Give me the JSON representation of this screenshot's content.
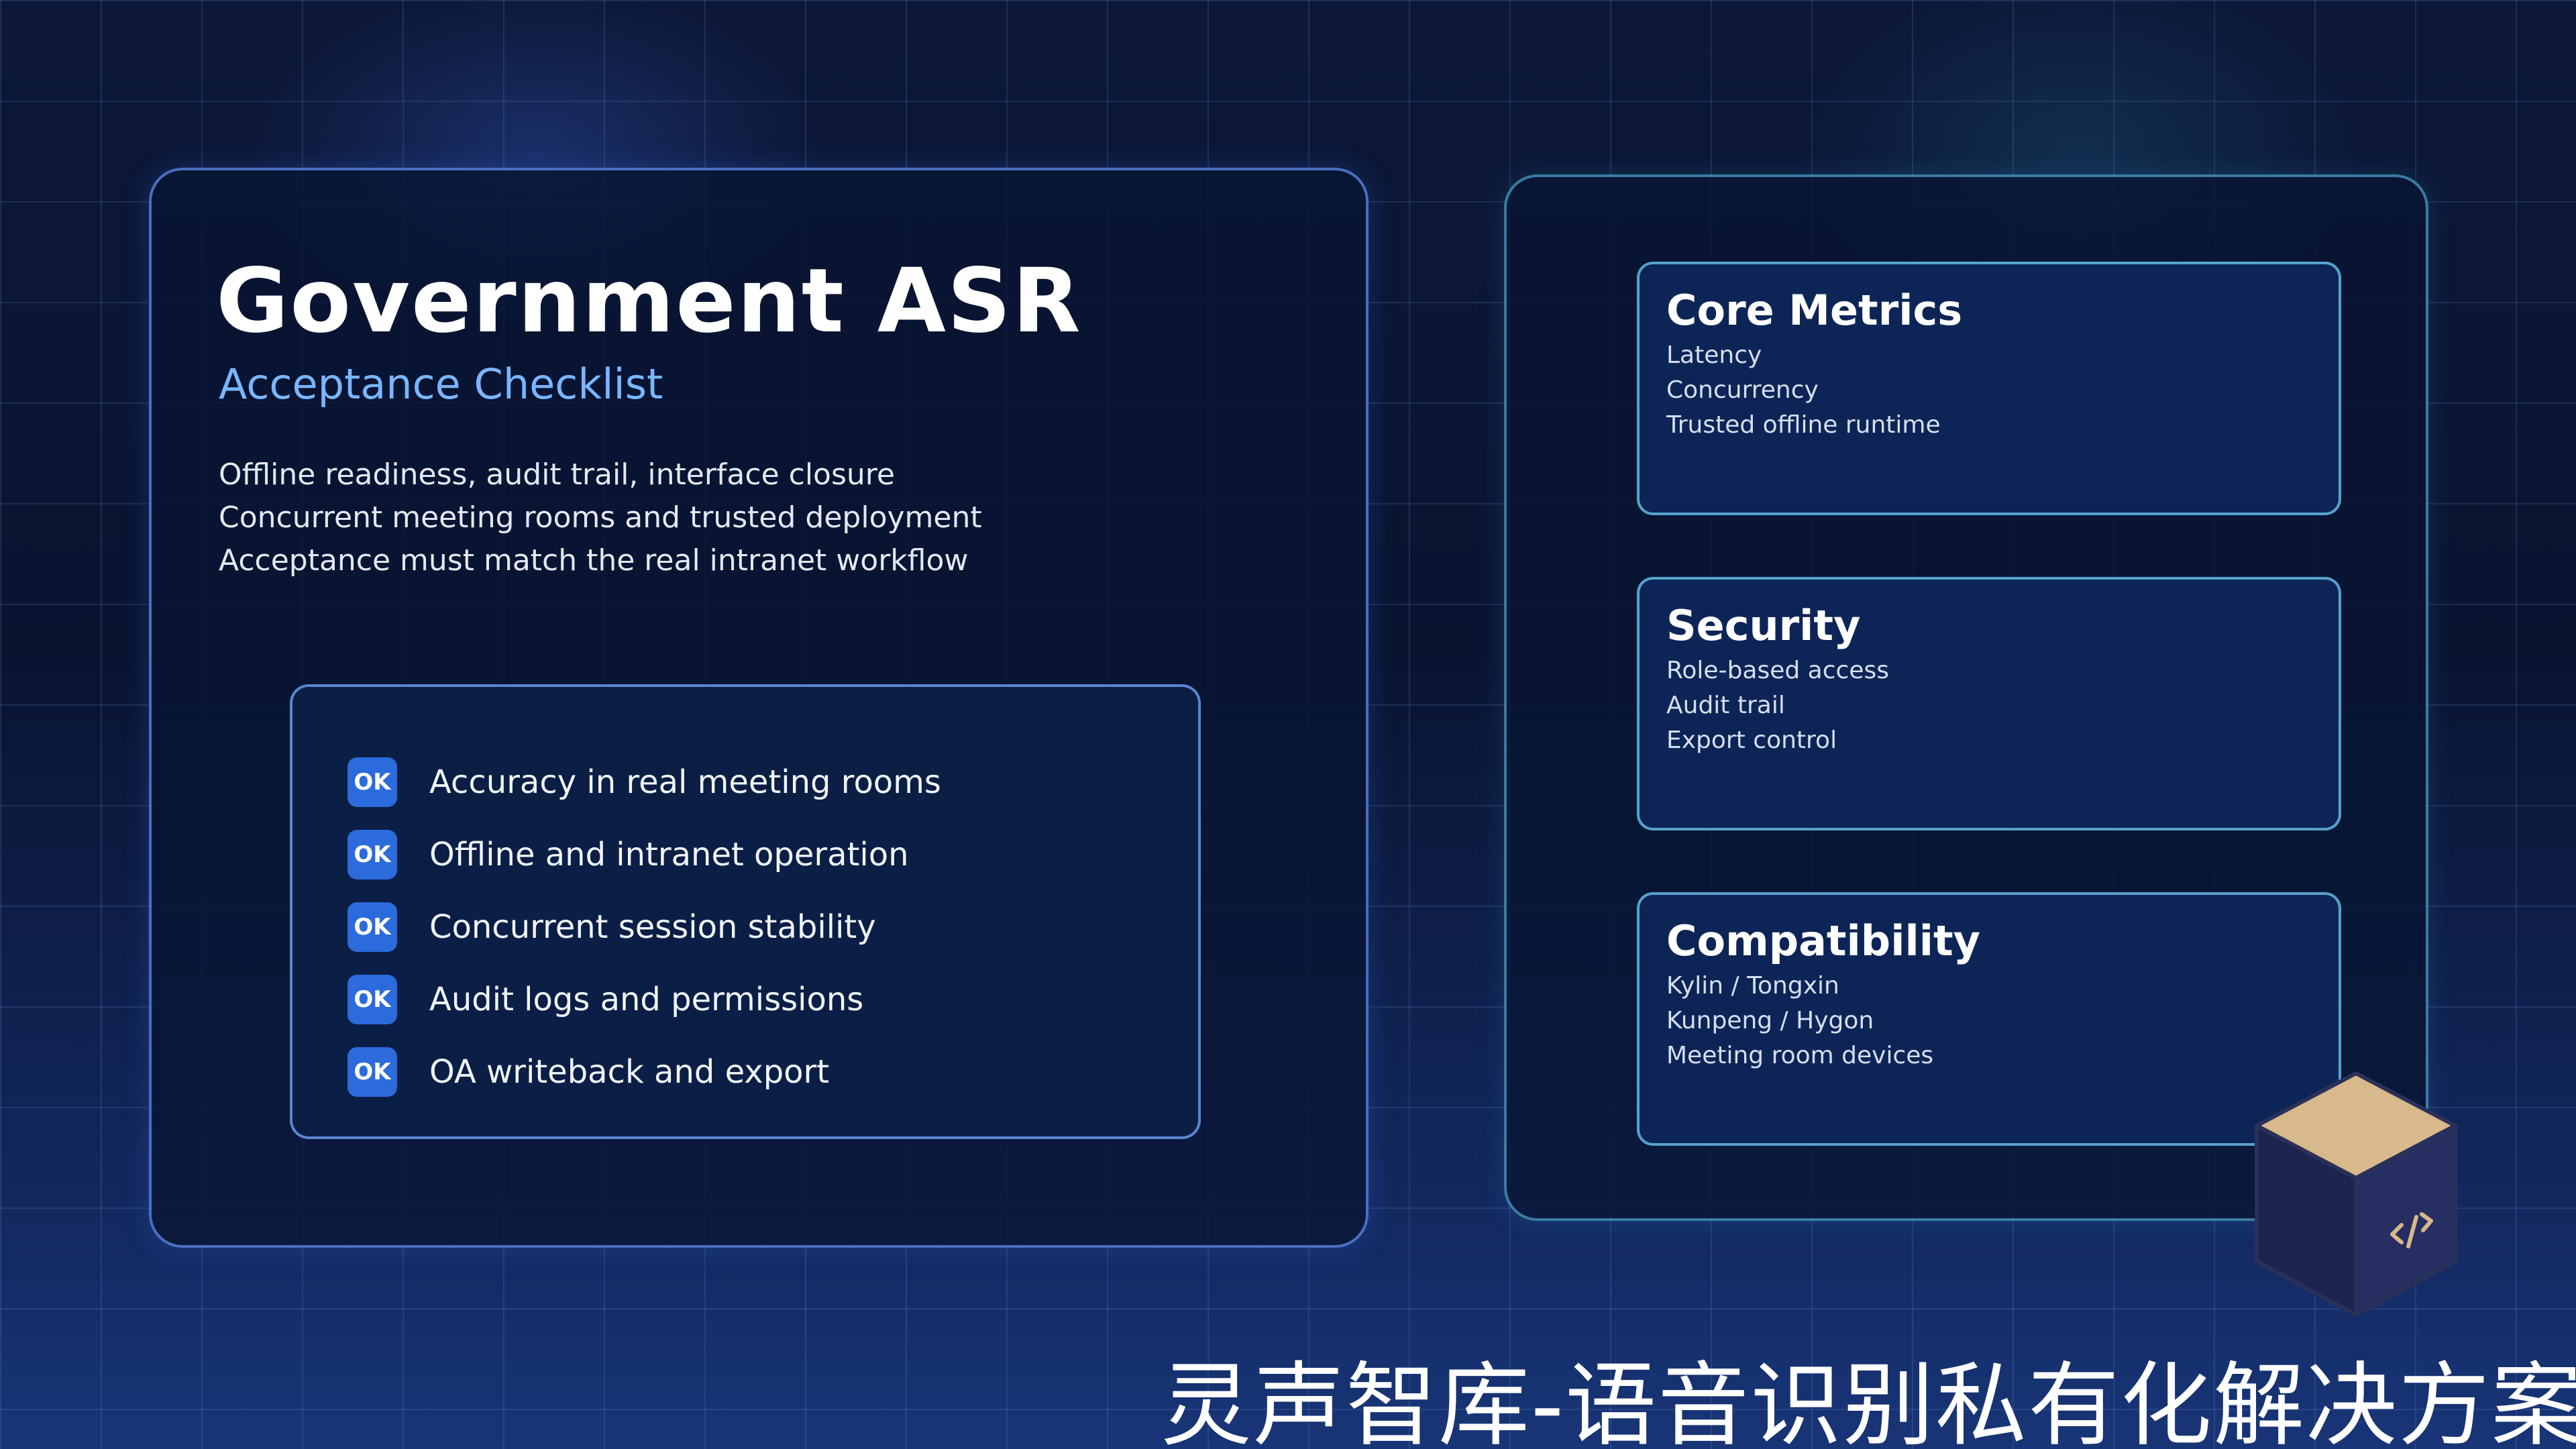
{
  "header": {
    "title": "Government ASR",
    "subtitle": "Acceptance Checklist",
    "description": [
      "Offline readiness, audit trail, interface closure",
      "Concurrent meeting rooms and trusted deployment",
      "Acceptance must match the real intranet workflow"
    ]
  },
  "checklist": {
    "badge": "OK",
    "items": [
      "Accuracy in real meeting rooms",
      "Offline and intranet operation",
      "Concurrent session stability",
      "Audit logs and permissions",
      "OA writeback and export"
    ]
  },
  "cards": [
    {
      "title": "Core Metrics",
      "items": [
        "Latency",
        "Concurrency",
        "Trusted offline runtime"
      ]
    },
    {
      "title": "Security",
      "items": [
        "Role-based access",
        "Audit trail",
        "Export control"
      ]
    },
    {
      "title": "Compatibility",
      "items": [
        "Kylin / Tongxin",
        "Kunpeng / Hygon",
        "Meeting room devices"
      ]
    }
  ],
  "watermark": "灵声智库-语音识别私有化解决方案",
  "icons": {
    "badge": "ok-badge-icon",
    "cube": "code-cube-icon"
  },
  "colors": {
    "accent": "#79b6ff",
    "badge": "#2b6bdc",
    "card_border": "#64b9e1",
    "background": "#0b1634"
  }
}
